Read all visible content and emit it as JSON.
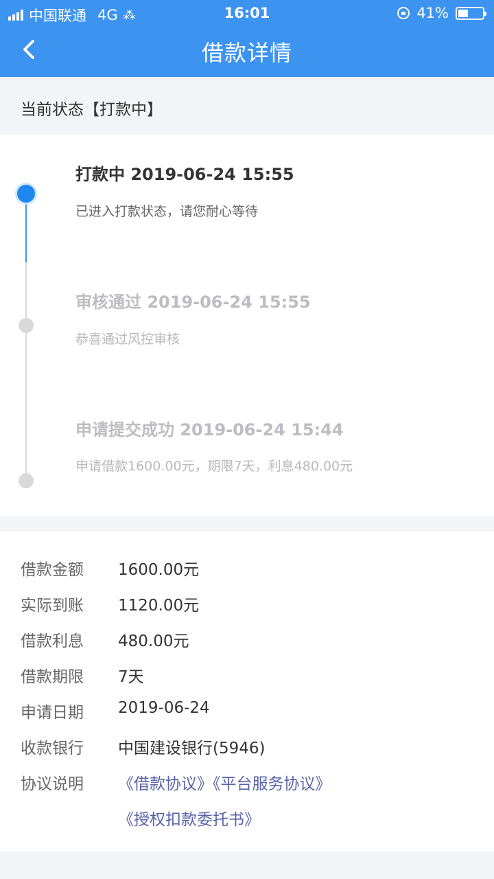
{
  "status_bar": {
    "carrier": "中国联通",
    "network": "4G",
    "time": "16:01",
    "battery_percent": "41%",
    "battery_level": 0.41
  },
  "nav": {
    "title": "借款详情"
  },
  "current_status": "当前状态【打款中】",
  "timeline": [
    {
      "title": "打款中 2019-06-24 15:55",
      "desc": "已进入打款状态，请您耐心等待",
      "active": true
    },
    {
      "title": "审核通过 2019-06-24 15:55",
      "desc": "恭喜通过风控审核",
      "active": false
    },
    {
      "title": "申请提交成功 2019-06-24 15:44",
      "desc": "申请借款1600.00元，期限7天，利息480.00元",
      "active": false
    }
  ],
  "details": {
    "loan_amount": {
      "label": "借款金额",
      "value": "1600.00元"
    },
    "actual_received": {
      "label": "实际到账",
      "value": "1120.00元"
    },
    "interest": {
      "label": "借款利息",
      "value": "480.00元"
    },
    "term": {
      "label": "借款期限",
      "value": "7天"
    },
    "apply_date": {
      "label": "申请日期",
      "value": "2019-06-24"
    },
    "bank": {
      "label": "收款银行",
      "value": "中国建设银行(5946)"
    },
    "agreement": {
      "label": "协议说明",
      "links": [
        "《借款协议》",
        "《平台服务协议》",
        "《授权扣款委托书》"
      ]
    }
  },
  "colors": {
    "header": "#3d93f0",
    "active_dot": "#1e88f0",
    "link": "#5a64a8"
  }
}
